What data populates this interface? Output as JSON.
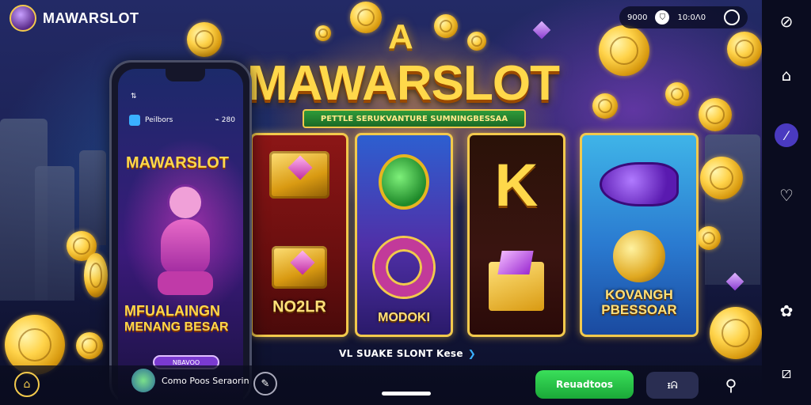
{
  "brand": {
    "name": "MAWARSLOT"
  },
  "status": {
    "left_value": "9000",
    "right_value": "10:0Ʌ0"
  },
  "title": {
    "a": "A",
    "main": "MAWARSLOT",
    "ribbon": "PETTLE SERUKVANTURE SUMNINGBESSAA"
  },
  "reels": {
    "labels": [
      "NO2LR",
      "MODOKI",
      "KOVANGH PBESSOAR"
    ],
    "corner_glyph": "K"
  },
  "caption": {
    "text": "VL SUAKE SLONT Kese",
    "arrow": "❯"
  },
  "phone": {
    "status_glyph": "⇅",
    "header_left": "Peilbors",
    "header_right": "⌁ 280",
    "brand": "MAWARSLOT",
    "headline": "MFUALAINGN",
    "subline": "MENANG BESAR",
    "button": "NBAVOO"
  },
  "bottombar": {
    "app_text": "Como Poos Seraorin",
    "green_button": "Reuadtoos",
    "small_button": "ᵻᕱ"
  },
  "icons": {
    "rail": [
      "compass-icon",
      "dog-icon",
      "slash-circle-icon",
      "heart-icon",
      "paw-icon",
      "edit-square-icon"
    ]
  }
}
